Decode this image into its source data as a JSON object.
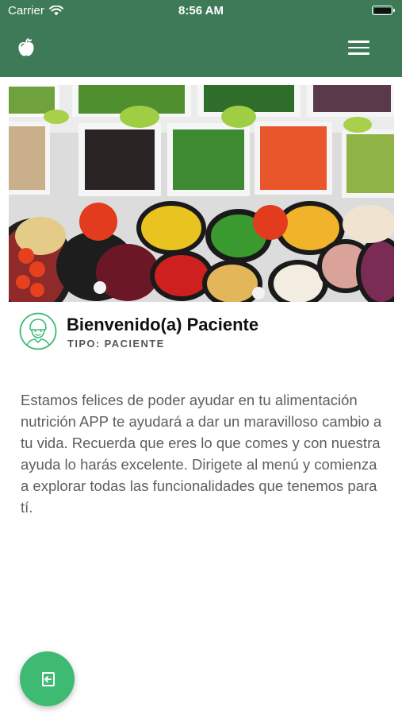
{
  "status_bar": {
    "carrier": "Carrier",
    "time": "8:56 AM",
    "icons": [
      "wifi-icon",
      "battery-icon"
    ]
  },
  "header": {
    "background_color": "#3f7a58",
    "logo_icon": "apple-icon",
    "menu_icon": "hamburger-menu-icon"
  },
  "hero": {
    "image_subject": "vegetables-in-bowls-photo"
  },
  "profile": {
    "avatar_icon": "user-avatar-icon",
    "title": "Bienvenido(a) Paciente",
    "role": "TIPO: PACIENTE"
  },
  "content": {
    "description": "Estamos felices de poder ayudar en tu alimentación nutrición APP te ayudará a dar un maravilloso cambio a tu vida. Recuerda que eres lo que comes y con nuestra ayuda lo harás excelente. Dirigete al menú y comienza a explorar todas las funcionalidades que tenemos para tí."
  },
  "fab": {
    "icon": "logout-icon",
    "color": "#3fba73"
  }
}
